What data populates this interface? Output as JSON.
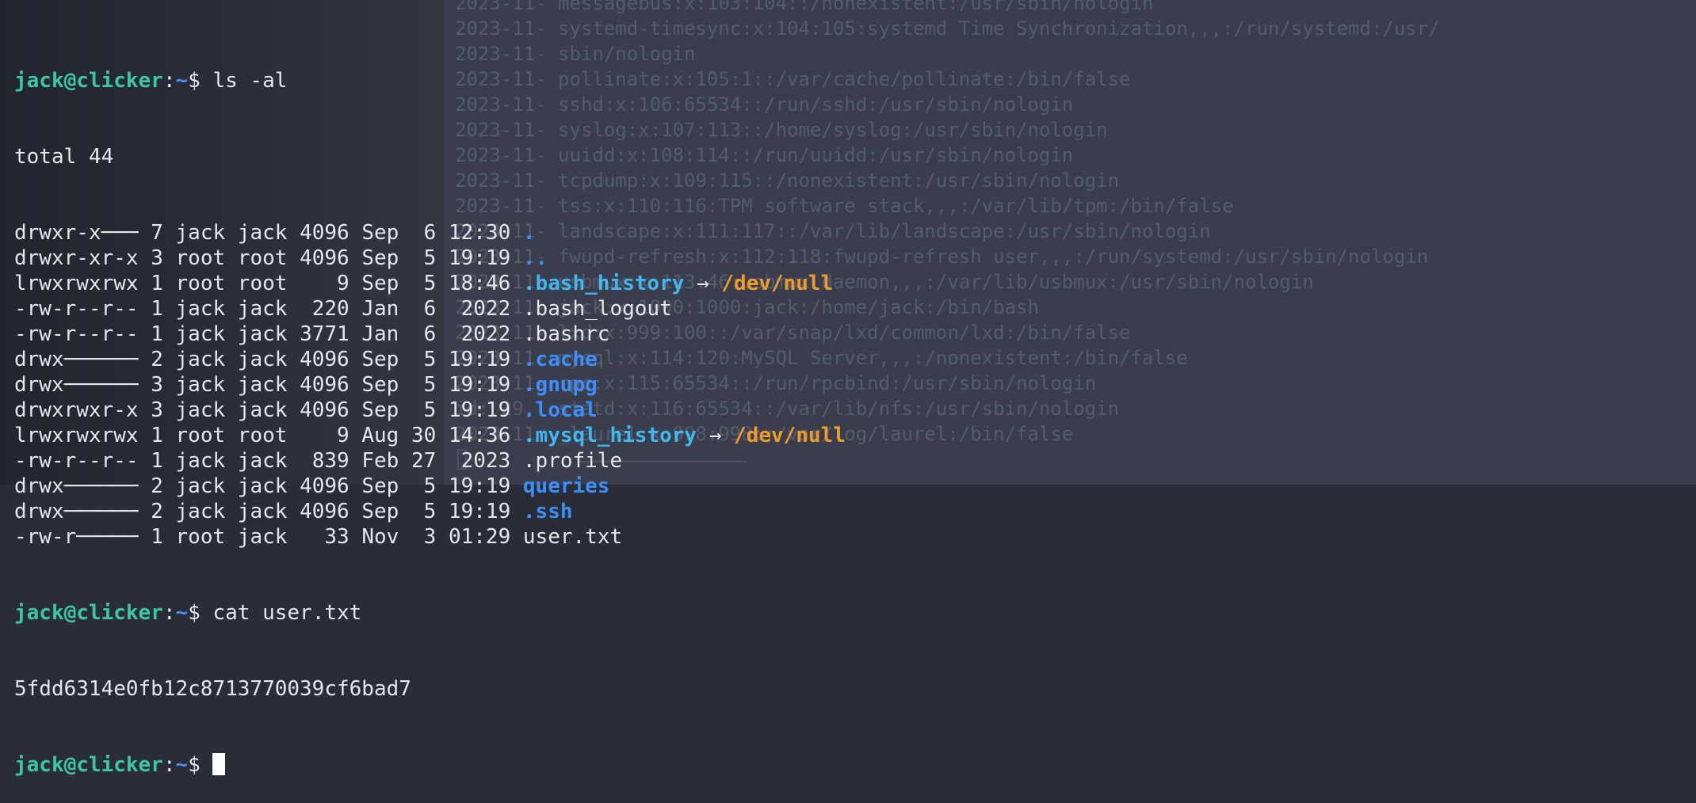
{
  "prompt": {
    "user": "jack@clicker",
    "sep": ":",
    "path": "~",
    "symbol": "$ "
  },
  "commands": {
    "first": "ls -al",
    "second": "cat user.txt",
    "third": ""
  },
  "total_line": "total 44",
  "listing": [
    {
      "perm": "drwxr-x───",
      "links": "7",
      "owner": "jack",
      "group": "jack",
      "size": "4096",
      "month": "Sep",
      "day": " 6",
      "time": "12:30",
      "name": ".",
      "kind": "dir",
      "target": ""
    },
    {
      "perm": "drwxr-xr-x",
      "links": "3",
      "owner": "root",
      "group": "root",
      "size": "4096",
      "month": "Sep",
      "day": " 5",
      "time": "19:19",
      "name": "..",
      "kind": "dir",
      "target": ""
    },
    {
      "perm": "lrwxrwxrwx",
      "links": "1",
      "owner": "root",
      "group": "root",
      "size": "   9",
      "month": "Sep",
      "day": " 5",
      "time": "18:46",
      "name": ".bash_history",
      "kind": "link",
      "target": "/dev/null"
    },
    {
      "perm": "-rw-r--r--",
      "links": "1",
      "owner": "jack",
      "group": "jack",
      "size": " 220",
      "month": "Jan",
      "day": " 6",
      "time": " 2022",
      "name": ".bash_logout",
      "kind": "file",
      "target": ""
    },
    {
      "perm": "-rw-r--r--",
      "links": "1",
      "owner": "jack",
      "group": "jack",
      "size": "3771",
      "month": "Jan",
      "day": " 6",
      "time": " 2022",
      "name": ".bashrc",
      "kind": "file",
      "target": ""
    },
    {
      "perm": "drwx──────",
      "links": "2",
      "owner": "jack",
      "group": "jack",
      "size": "4096",
      "month": "Sep",
      "day": " 5",
      "time": "19:19",
      "name": ".cache",
      "kind": "dir",
      "target": ""
    },
    {
      "perm": "drwx──────",
      "links": "3",
      "owner": "jack",
      "group": "jack",
      "size": "4096",
      "month": "Sep",
      "day": " 5",
      "time": "19:19",
      "name": ".gnupg",
      "kind": "dir",
      "target": ""
    },
    {
      "perm": "drwxrwxr-x",
      "links": "3",
      "owner": "jack",
      "group": "jack",
      "size": "4096",
      "month": "Sep",
      "day": " 5",
      "time": "19:19",
      "name": ".local",
      "kind": "dir",
      "target": ""
    },
    {
      "perm": "lrwxrwxrwx",
      "links": "1",
      "owner": "root",
      "group": "root",
      "size": "   9",
      "month": "Aug",
      "day": "30",
      "time": "14:36",
      "name": ".mysql_history",
      "kind": "link",
      "target": "/dev/null"
    },
    {
      "perm": "-rw-r--r--",
      "links": "1",
      "owner": "jack",
      "group": "jack",
      "size": " 839",
      "month": "Feb",
      "day": "27",
      "time": " 2023",
      "name": ".profile",
      "kind": "file",
      "target": ""
    },
    {
      "perm": "drwx──────",
      "links": "2",
      "owner": "jack",
      "group": "jack",
      "size": "4096",
      "month": "Sep",
      "day": " 5",
      "time": "19:19",
      "name": "queries",
      "kind": "dir",
      "target": ""
    },
    {
      "perm": "drwx──────",
      "links": "2",
      "owner": "jack",
      "group": "jack",
      "size": "4096",
      "month": "Sep",
      "day": " 5",
      "time": "19:19",
      "name": ".ssh",
      "kind": "dir",
      "target": ""
    },
    {
      "perm": "-rw-r─────",
      "links": "1",
      "owner": "root",
      "group": "jack",
      "size": "  33",
      "month": "Nov",
      "day": " 3",
      "time": "01:29",
      "name": "user.txt",
      "kind": "file",
      "target": ""
    }
  ],
  "link_arrow": " → ",
  "flag_output": "5fdd6314e0fb12c8713770039cf6bad7",
  "background_text": [
    "2023-11- messagebus:x:103:104::/nonexistent:/usr/sbin/nologin",
    "2023-11- systemd-timesync:x:104:105:systemd Time Synchronization,,,:/run/systemd:/usr/",
    "2023-11- sbin/nologin",
    "2023-11- pollinate:x:105:1::/var/cache/pollinate:/bin/false",
    "2023-11- sshd:x:106:65534::/run/sshd:/usr/sbin/nologin",
    "2023-11- syslog:x:107:113::/home/syslog:/usr/sbin/nologin",
    "2023-11- uuidd:x:108:114::/run/uuidd:/usr/sbin/nologin",
    "2023-11- tcpdump:x:109:115::/nonexistent:/usr/sbin/nologin",
    "2023-11- tss:x:110:116:TPM software stack,,,:/var/lib/tpm:/bin/false",
    "2023-11- landscape:x:111:117::/var/lib/landscape:/usr/sbin/nologin",
    "2023-11- fwupd-refresh:x:112:118:fwupd-refresh user,,,:/run/systemd:/usr/sbin/nologin",
    "2023-11- usbmux:x:113:46:usbmux daemon,,,:/var/lib/usbmux:/usr/sbin/nologin",
    "2023-11- jack:x:1000:1000:jack:/home/jack:/bin/bash",
    "2023-11- lxd:x:999:100::/var/snap/lxd/common/lxd:/bin/false",
    "2023-11- mysql:x:114:120:MySQL Server,,,:/nonexistent:/bin/false",
    "2023-11- rpc:x:115:65534::/run/rpcbind:/usr/sbin/nologin",
    "id: 29,  statd:x:116:65534::/var/lib/nfs:/usr/sbin/nologin",
    "2023-11- _laurel:x:998:998::/var/log/laurel:/bin/false"
  ]
}
